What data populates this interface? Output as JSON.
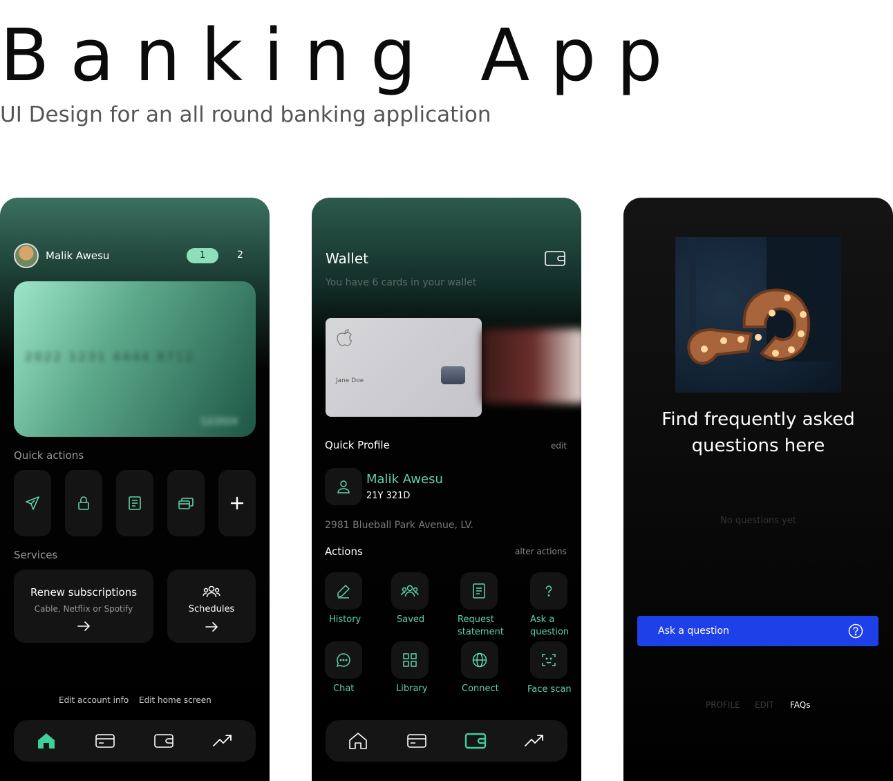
{
  "hero": {
    "title": "Banking App",
    "subtitle": "UI Design for an all round banking application"
  },
  "home": {
    "username": "Malik Awesu",
    "page_active": "1",
    "page_next": "2",
    "card_number": "2022 1231 4444 8712",
    "card_expiry": "12/2024",
    "quick_actions_label": "Quick actions",
    "quick_actions": [
      "send-icon",
      "lock-icon",
      "statement-icon",
      "cards-icon",
      "plus-icon"
    ],
    "services_label": "Services",
    "services": [
      {
        "title": "Renew subscriptions",
        "subtitle": "Cable, Netflix or Spotify"
      },
      {
        "title": "Schedules"
      }
    ],
    "edit_account": "Edit account info",
    "edit_home": "Edit home screen",
    "nav": [
      "home-icon",
      "card-icon",
      "wallet-icon",
      "trend-icon"
    ],
    "active_nav": "home-icon"
  },
  "wallet": {
    "title": "Wallet",
    "subtitle": "You have 6 cards in your wallet",
    "card_holder": "Jane Doe",
    "quick_profile_label": "Quick Profile",
    "edit_label": "edit",
    "profile_name": "Malik Awesu",
    "profile_id": "21Y 321D",
    "address": "2981 Blueball Park Avenue, LV.",
    "actions_label": "Actions",
    "alter_actions": "alter actions",
    "actions": [
      {
        "icon": "pencil-icon",
        "line1": "History",
        "line2": ""
      },
      {
        "icon": "users-icon",
        "line1": "Saved",
        "line2": ""
      },
      {
        "icon": "document-icon",
        "line1": "Request",
        "line2": "statement"
      },
      {
        "icon": "question-icon",
        "line1": "Ask a",
        "line2": "question"
      },
      {
        "icon": "chat-icon",
        "line1": "Chat",
        "line2": ""
      },
      {
        "icon": "grid-icon",
        "line1": "Library",
        "line2": ""
      },
      {
        "icon": "globe-icon",
        "line1": "Connect",
        "line2": ""
      },
      {
        "icon": "face-scan-icon",
        "line1": "Face scan",
        "line2": ""
      }
    ],
    "active_nav": "wallet-icon"
  },
  "faq": {
    "heading_line1": "Find frequently asked",
    "heading_line2": "questions here",
    "empty_text": "No questions yet",
    "ask_button": "Ask a question",
    "tabs": [
      "PROFILE",
      "EDIT",
      "FAQs"
    ],
    "active_tab": "FAQs"
  },
  "colors": {
    "accent_green": "#5fd3a8",
    "ask_blue": "#1e40e8",
    "background": "#000000"
  }
}
